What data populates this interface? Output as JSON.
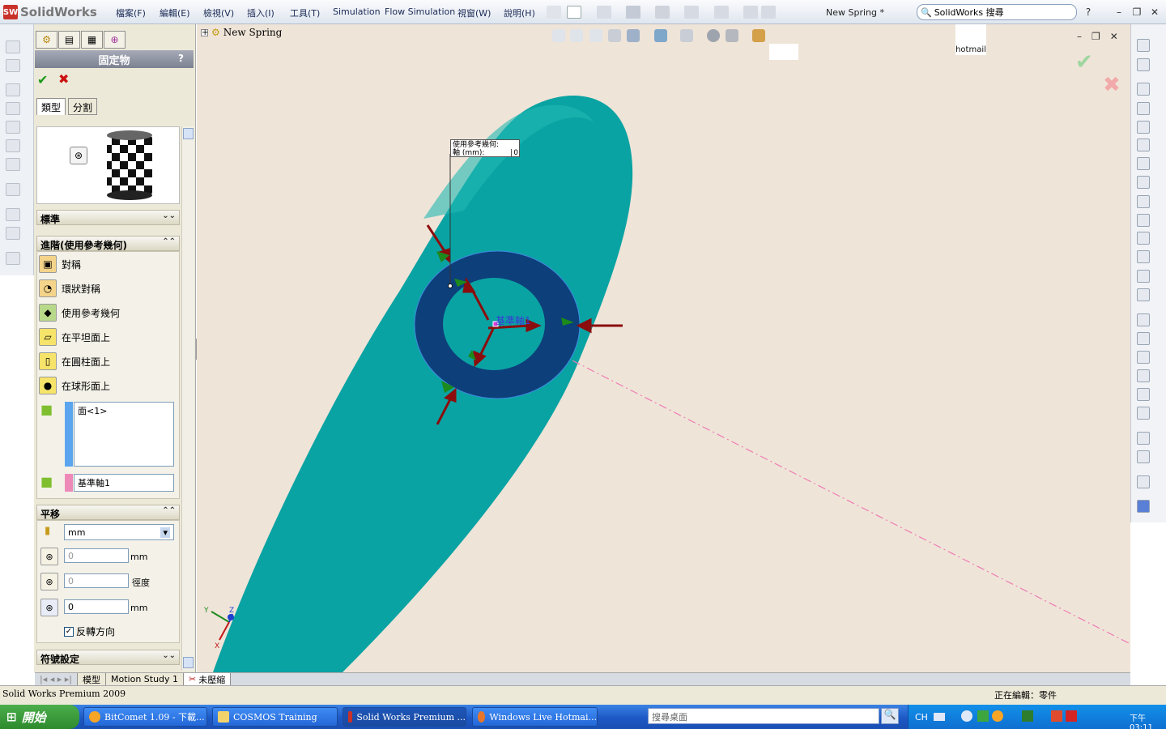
{
  "app": {
    "logo_text": "SolidWorks",
    "doc_title": "New Spring *",
    "search_placeholder": "SolidWorks 搜尋"
  },
  "menu": [
    "檔案(F)",
    "編輯(E)",
    "檢視(V)",
    "插入(I)",
    "工具(T)",
    "Simulation",
    "Flow Simulation",
    "視窗(W)",
    "說明(H)"
  ],
  "window_controls": {
    "help": "?",
    "min": "–",
    "restore": "❐",
    "close": "✕"
  },
  "property_manager": {
    "title": "固定物",
    "help": "?",
    "sub_tabs": [
      "類型",
      "分割"
    ],
    "section_standard": "標準",
    "section_advanced": "進階(使用參考幾何)",
    "options": [
      "對稱",
      "環狀對稱",
      "使用參考幾何",
      "在平坦面上",
      "在圓柱面上",
      "在球形面上"
    ],
    "faces_list": "面<1>",
    "axis_ref": "基準軸1",
    "section_translate": "平移",
    "unit": "mm",
    "field1_value": "0",
    "field1_unit": "mm",
    "field2_value": "0",
    "field2_unit": "徑度",
    "field3_value": "0",
    "field3_unit": "mm",
    "reverse_label": "反轉方向",
    "section_symbol": "符號設定"
  },
  "viewport": {
    "tree_root": "New Spring",
    "callout_line1": "使用參考幾何:",
    "callout_line2": "軸 (mm):",
    "callout_value": "0",
    "axis_label": "基準軸1",
    "hotmail": "hotmail",
    "triad": {
      "x": "X",
      "y": "Y",
      "z": "Z"
    }
  },
  "bottom_tabs": [
    "模型",
    "Motion Study 1",
    "未壓縮"
  ],
  "status": {
    "left": "Solid Works Premium 2009",
    "right": "正在編輯：零件"
  },
  "taskbar": {
    "start": "開始",
    "tasks": [
      "BitComet 1.09 - 下載...",
      "COSMOS Training",
      "Solid Works Premium ...",
      "Windows Live Hotmai..."
    ],
    "desktop_search": "搜尋桌面",
    "lang": "CH",
    "clock": "下午 03:11"
  },
  "colors": {
    "viewport_bg": "#efe4d8",
    "model_body": "#0aa3a3",
    "ring": "#0d3f7a",
    "arrow_red": "#8b0d0d",
    "arrow_green": "#1c8a1c",
    "axis_line": "#ee7db4"
  }
}
